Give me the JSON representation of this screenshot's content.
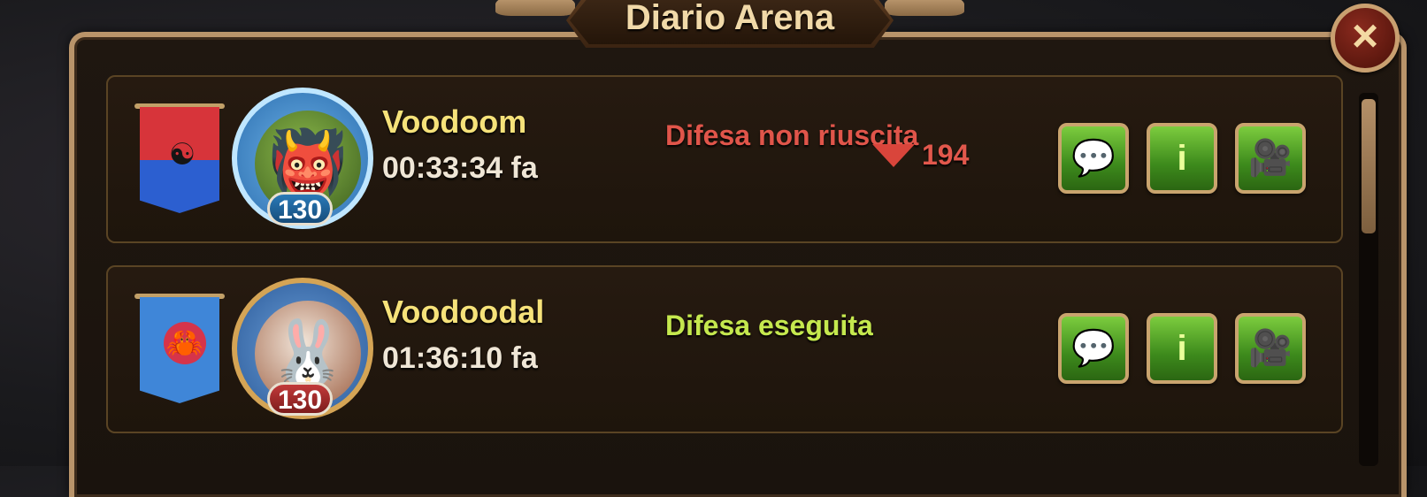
{
  "window": {
    "title": "Diario Arena",
    "close_icon": "×"
  },
  "colors": {
    "defeat": "#e0554a",
    "victory": "#c5e84e",
    "name": "#f6e27a"
  },
  "entries": [
    {
      "name": "Voodoom",
      "time_ago": "00:33:34 fa",
      "result": "Difesa non riuscita",
      "result_type": "defeat",
      "rank_change": "194",
      "level": "130",
      "banner_icon": "dragon-emblem",
      "avatar": "orc-hero-portrait",
      "actions": {
        "chat": "💬",
        "info": "i",
        "replay": "🎥"
      }
    },
    {
      "name": "Voodoodal",
      "time_ago": "01:36:10 fa",
      "result": "Difesa eseguita",
      "result_type": "victory",
      "level": "130",
      "banner_icon": "crab-emblem",
      "avatar": "rabbit-hero-portrait",
      "actions": {
        "chat": "💬",
        "info": "i",
        "replay": "🎥"
      }
    }
  ]
}
